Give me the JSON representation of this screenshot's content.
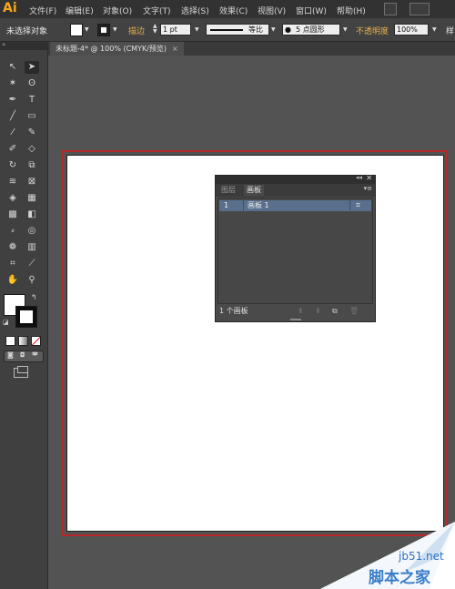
{
  "app": {
    "logo": "Ai"
  },
  "menu": {
    "items": [
      "文件(F)",
      "编辑(E)",
      "对象(O)",
      "文字(T)",
      "选择(S)",
      "效果(C)",
      "视图(V)",
      "窗口(W)",
      "帮助(H)"
    ]
  },
  "control_bar": {
    "selection_status": "未选择对象",
    "stroke_label": "描边",
    "stroke_weight": "1 pt",
    "stroke_profile": "等比",
    "brush": "5 点圆形",
    "opacity_label": "不透明度",
    "opacity_value": "100%",
    "style_label": "样"
  },
  "document": {
    "tab_title": "未标题-4* @ 100% (CMYK/预览)",
    "tab_close": "×"
  },
  "panel": {
    "tab_layers": "图层",
    "tab_artboards": "画板",
    "rows": [
      {
        "number": "1",
        "name": "画板 1"
      }
    ],
    "footer_count": "1 个画板"
  },
  "watermark": {
    "site": "jb51.net",
    "cn": "脚本之家"
  },
  "colors": {
    "menubar": "#323232",
    "toolbar": "#424242",
    "pasteboard": "#535353",
    "artboard_border": "#b4282a",
    "row_highlight": "#5a6f8c",
    "logo": "#f7a81b"
  }
}
